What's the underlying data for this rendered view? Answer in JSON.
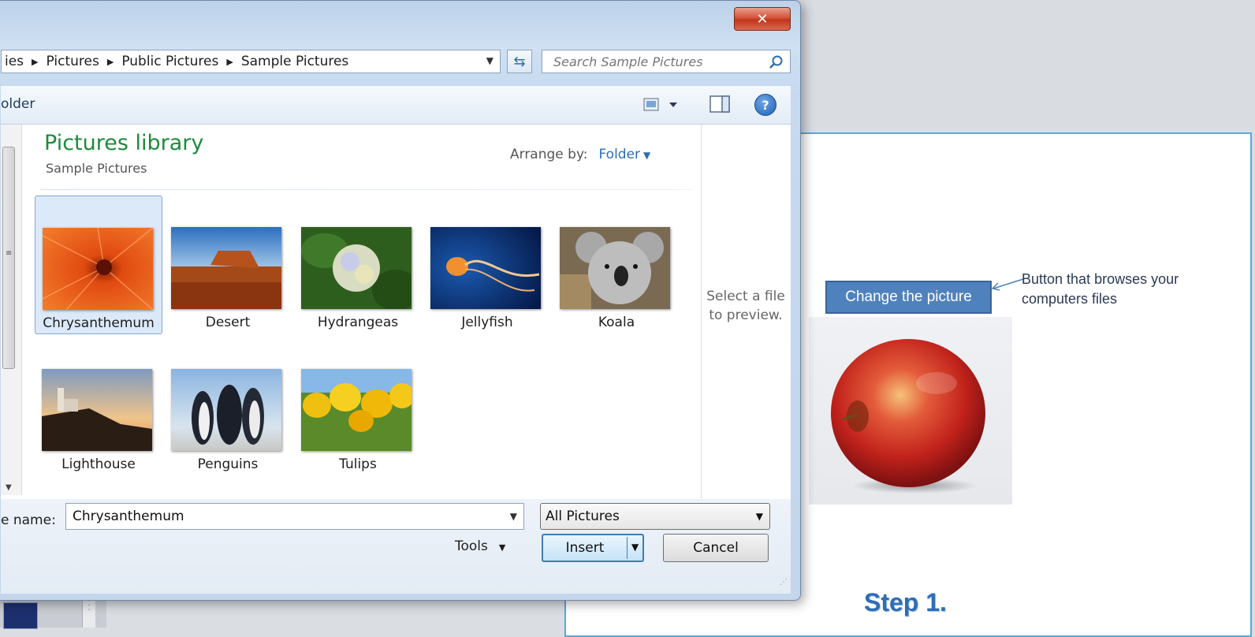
{
  "dialog": {
    "address": {
      "segments": [
        "ies",
        "Pictures",
        "Public Pictures",
        "Sample Pictures"
      ]
    },
    "search": {
      "placeholder": "Search Sample Pictures"
    },
    "toolbar": {
      "organize_label": "older"
    },
    "library": {
      "title": "Pictures library",
      "subtitle": "Sample Pictures",
      "arrange_label": "Arrange by:",
      "arrange_value": "Folder"
    },
    "files": [
      {
        "name": "Chrysanthemum",
        "selected": true
      },
      {
        "name": "Desert"
      },
      {
        "name": "Hydrangeas"
      },
      {
        "name": "Jellyfish"
      },
      {
        "name": "Koala"
      },
      {
        "name": "Lighthouse"
      },
      {
        "name": "Penguins"
      },
      {
        "name": "Tulips"
      }
    ],
    "preview_text": "Select a file to preview.",
    "filename_label": "e name:",
    "filename_value": "Chrysanthemum",
    "filetype_value": "All Pictures",
    "tools_label": "Tools",
    "insert_label": "Insert",
    "cancel_label": "Cancel",
    "close_glyph": "✕"
  },
  "slide": {
    "change_button": "Change the picture",
    "annotation": "Button that  browses your computers files",
    "step_label": "Step 1."
  },
  "colors": {
    "library_title": "#1e8a3c",
    "link_blue": "#2e6db4",
    "change_button_bg": "#4f81bd",
    "step_text": "#2f6db5"
  }
}
